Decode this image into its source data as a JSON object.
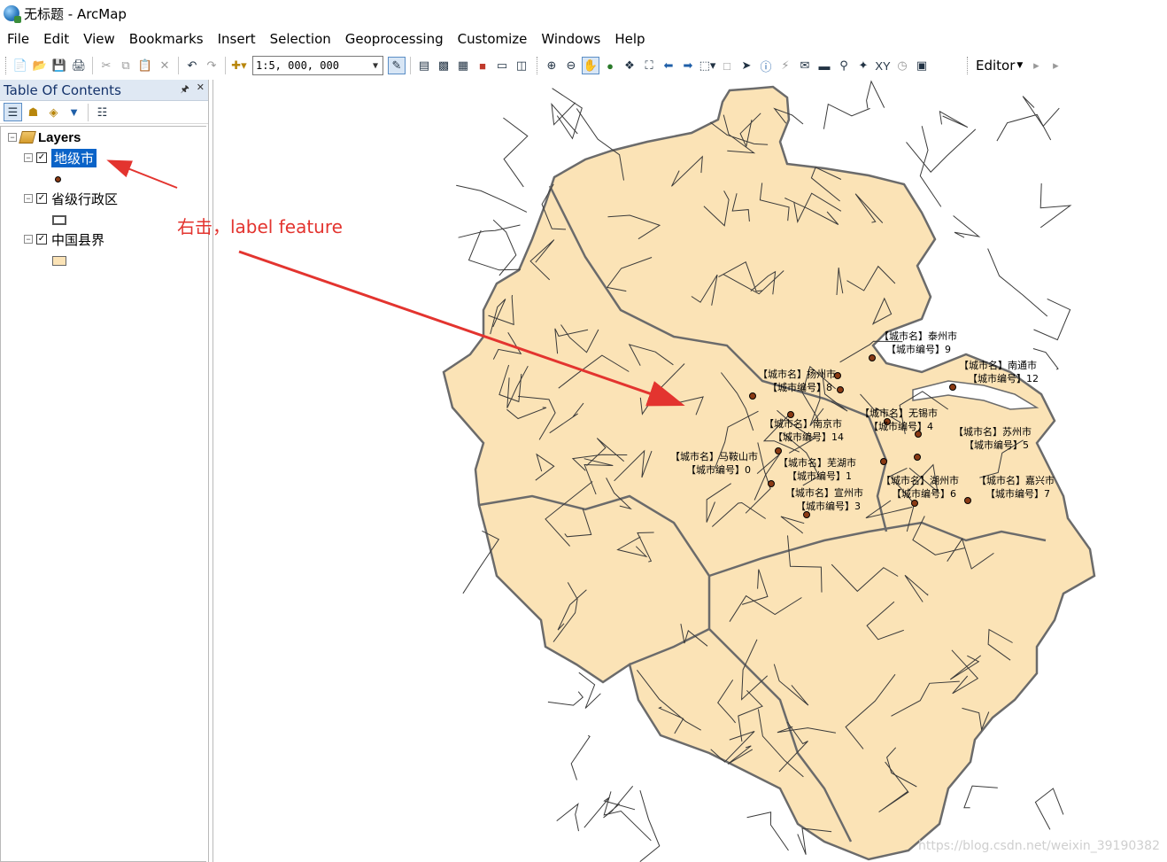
{
  "window": {
    "title": "无标题 - ArcMap"
  },
  "menu": [
    "File",
    "Edit",
    "View",
    "Bookmarks",
    "Insert",
    "Selection",
    "Geoprocessing",
    "Customize",
    "Windows",
    "Help"
  ],
  "toolbar": {
    "scale_value": "1:5, 000, 000",
    "editor_label": "Editor"
  },
  "toc": {
    "title": "Table Of Contents",
    "root_label": "Layers",
    "layers": [
      {
        "label": "地级市",
        "selected": true,
        "checked": true,
        "symbol": "point"
      },
      {
        "label": "省级行政区",
        "selected": false,
        "checked": true,
        "symbol": "hollow-polygon"
      },
      {
        "label": "中国县界",
        "selected": false,
        "checked": true,
        "symbol": "filled-polygon"
      }
    ]
  },
  "annotation": {
    "text": "右击，label feature",
    "color": "#e3342f"
  },
  "colors": {
    "map_fill": "#fbe3b6",
    "province_border": "#6b6b6b",
    "county_border": "#3a3a3a",
    "city_point": "#8a3a14"
  },
  "map_labels": [
    {
      "name": "【城市名】泰州市",
      "code": "【城市编号】9"
    },
    {
      "name": "【城市名】南通市",
      "code": "【城市编号】12"
    },
    {
      "name": "【城市名】扬州市",
      "code": "【城市编号】8"
    },
    {
      "name": "【城市名】无锡市",
      "code": "【城市编号】4"
    },
    {
      "name": "【城市名】南京市",
      "code": "【城市编号】14"
    },
    {
      "name": "【城市名】苏州市",
      "code": "【城市编号】5"
    },
    {
      "name": "【城市名】马鞍山市",
      "code": "【城市编号】0"
    },
    {
      "name": "【城市名】芜湖市",
      "code": "【城市编号】1"
    },
    {
      "name": "【城市名】湖州市",
      "code": "【城市编号】6"
    },
    {
      "name": "【城市名】嘉兴市",
      "code": "【城市编号】7"
    },
    {
      "name": "【城市名】宣州市",
      "code": "【城市编号】3"
    }
  ],
  "watermark": "https://blog.csdn.net/weixin_39190382"
}
